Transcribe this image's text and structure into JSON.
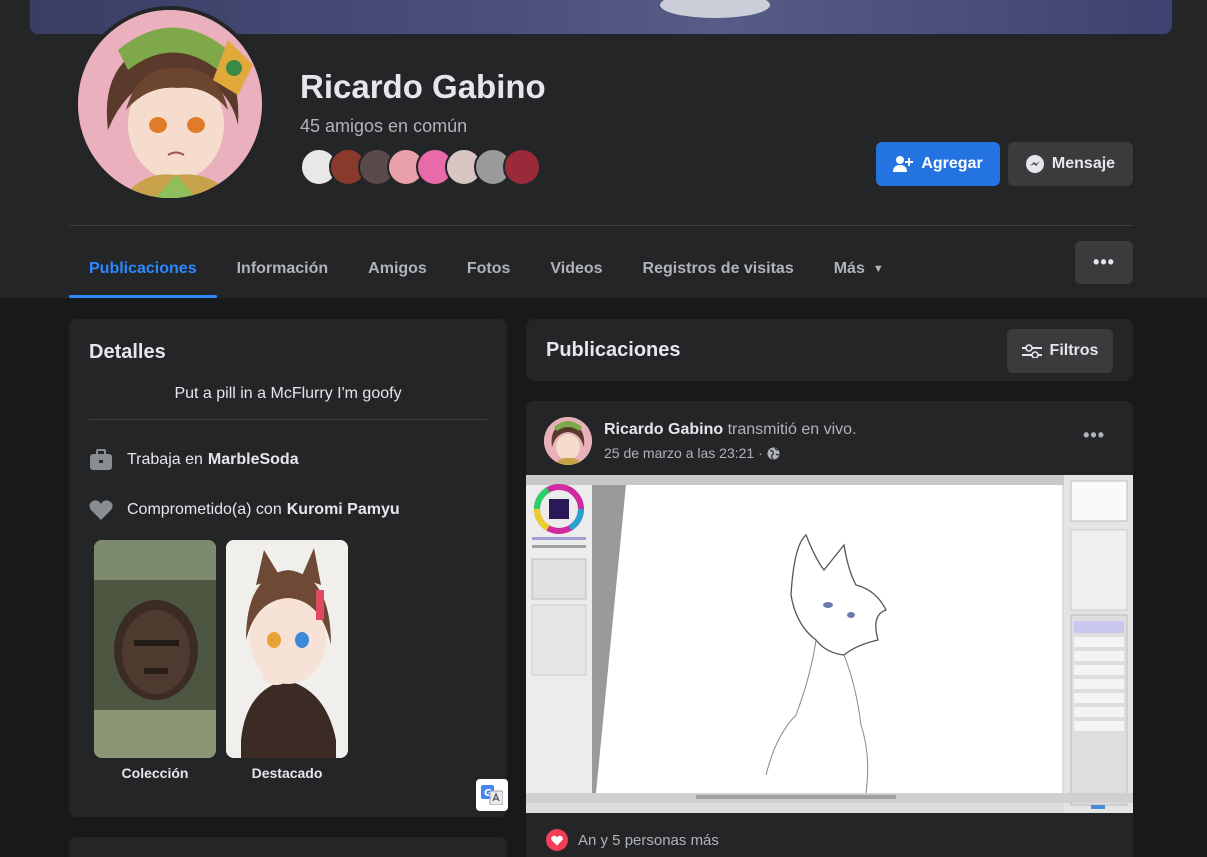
{
  "profile": {
    "name": "Ricardo Gabino",
    "mutual_friends": "45 amigos en común",
    "add_button": "Agregar",
    "message_button": "Mensaje"
  },
  "tabs": [
    {
      "label": "Publicaciones",
      "active": true
    },
    {
      "label": "Información"
    },
    {
      "label": "Amigos"
    },
    {
      "label": "Fotos"
    },
    {
      "label": "Videos"
    },
    {
      "label": "Registros de visitas"
    },
    {
      "label": "Más"
    }
  ],
  "details": {
    "title": "Detalles",
    "bio": "Put a pill in a McFlurry I'm goofy",
    "work_prefix": "Trabaja en",
    "work_place": "MarbleSoda",
    "relationship_prefix": "Comprometido(a) con",
    "relationship_partner": "Kuromi Pamyu",
    "featured": [
      {
        "label": "Colección"
      },
      {
        "label": "Destacado"
      }
    ]
  },
  "posts_section": {
    "title": "Publicaciones",
    "filter_button": "Filtros"
  },
  "post": {
    "author": "Ricardo Gabino",
    "action": "transmitió en vivo.",
    "date": "25 de marzo a las 23:21 ·",
    "reactions": "An y 5 personas más"
  },
  "colors": {
    "accent": "#2d88ff",
    "primary_button": "#2374e1",
    "card": "#242526",
    "background": "#18191a",
    "love": "#f33e58"
  }
}
